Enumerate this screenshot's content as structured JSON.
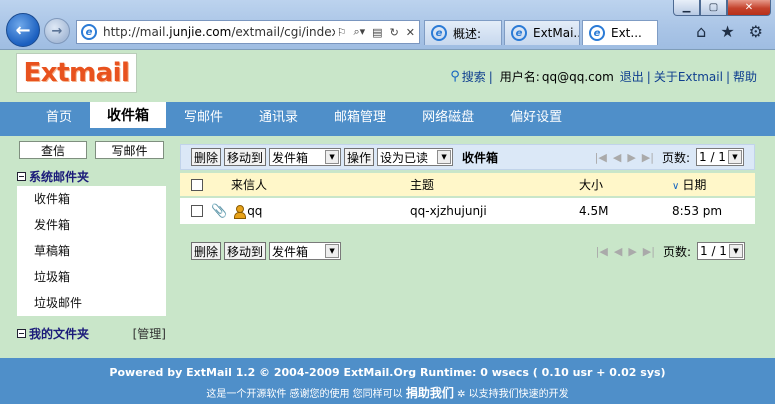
{
  "browser": {
    "url_prefix": "http://mail.",
    "url_host": "junjie.com",
    "url_suffix": "/extmail/cgi/index",
    "tabs": [
      {
        "label": "概述:"
      },
      {
        "label": "ExtMai..."
      },
      {
        "label": "Ext..."
      }
    ]
  },
  "header": {
    "logo_text": "Extmail",
    "search_label": "搜索",
    "user_label": "用户名:",
    "user_email": "qq@qq.com",
    "logout_label": "退出",
    "about_label": "关于Extmail",
    "help_label": "帮助"
  },
  "nav": {
    "items": [
      "首页",
      "收件箱",
      "写邮件",
      "通讯录",
      "邮箱管理",
      "网络磁盘",
      "偏好设置"
    ]
  },
  "sidebar": {
    "search_button": "查信",
    "compose_button": "写邮件",
    "system_folders_title": "系统邮件夹",
    "folders": [
      "收件箱",
      "发件箱",
      "草稿箱",
      "垃圾箱",
      "垃圾邮件"
    ],
    "my_folders_title": "我的文件夹",
    "manage_label": "[管理]"
  },
  "toolbar": {
    "delete_label": "删除",
    "move_label": "移动到",
    "move_target": "发件箱",
    "action_label": "操作",
    "mark_label": "设为已读",
    "folder_title": "收件箱",
    "page_label": "页数:",
    "page_value": "1 / 1"
  },
  "list": {
    "headers": {
      "from": "来信人",
      "subject": "主题",
      "size": "大小",
      "date": "日期"
    },
    "rows": [
      {
        "from": "qq",
        "subject": "qq-xjzhujunji",
        "size": "4.5M",
        "date": "8:53 pm"
      }
    ]
  },
  "footer": {
    "line1": "Powered by ExtMail 1.2 © 2004-2009 ExtMail.Org Runtime: 0 wsecs ( 0.10 usr + 0.02 sys)",
    "line2_a": "这是一个开源软件 感谢您的使用 您同样可以",
    "donate": "捐助我们",
    "line2_b": "以支持我们快速的开发"
  },
  "colors": {
    "page_bg": "#c9e6c9",
    "nav_bg": "#4f8fc9",
    "logo": "#e8521e",
    "header_row": "#fff7c9"
  }
}
